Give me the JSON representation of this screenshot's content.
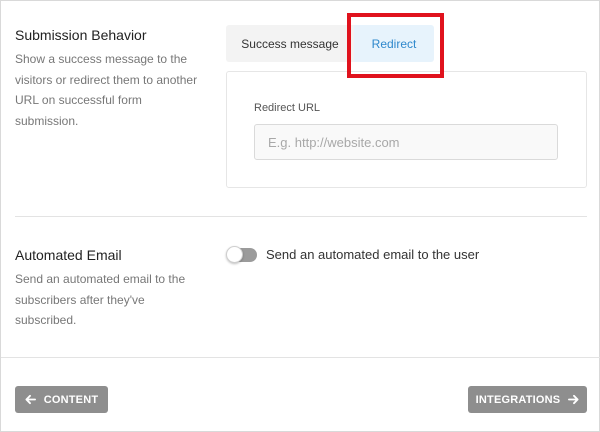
{
  "submission": {
    "title": "Submission Behavior",
    "description": "Show a success message to the visitors or redirect them to another URL on successful form submission.",
    "tabs": {
      "success_label": "Success message",
      "redirect_label": "Redirect",
      "active": "Redirect"
    },
    "redirect": {
      "field_label": "Redirect URL",
      "placeholder": "E.g. http://website.com",
      "value": ""
    }
  },
  "automated_email": {
    "title": "Automated Email",
    "description": "Send an automated email to the subscribers after they've subscribed.",
    "toggle_label": "Send an automated email to the user",
    "toggle_on": false
  },
  "footer": {
    "back_label": "CONTENT",
    "back_icon": "arrow-left-icon",
    "next_label": "INTEGRATIONS",
    "next_icon": "arrow-right-icon"
  },
  "colors": {
    "highlight": "#e0121d",
    "active_tab_bg": "#e7f3fc",
    "active_tab_text": "#2f88cc",
    "button_bg": "#8e8e8e"
  }
}
